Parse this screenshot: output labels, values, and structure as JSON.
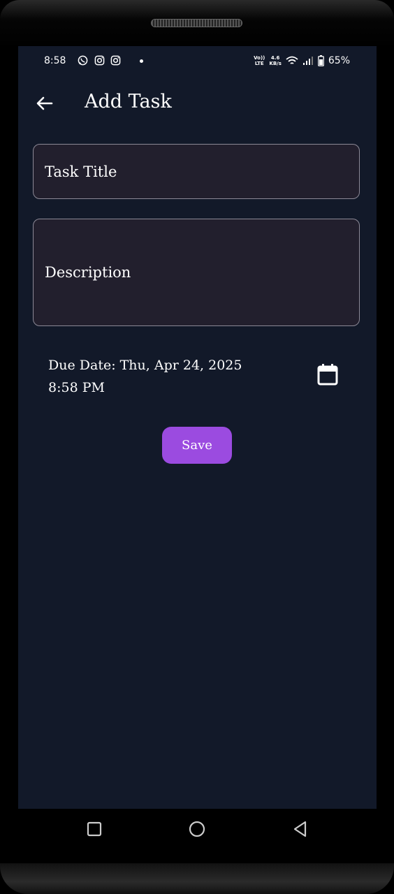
{
  "status_bar": {
    "time": "8:58",
    "net_speed_top": "4.6",
    "net_speed_bottom": "KB/s",
    "volte_top": "Vo))",
    "volte_bottom": "LTE",
    "battery": "65%"
  },
  "app_bar": {
    "title": "Add Task"
  },
  "form": {
    "title_placeholder": "Task Title",
    "description_placeholder": "Description",
    "due_date_line1": "Due Date: Thu, Apr 24, 2025",
    "due_date_line2": "8:58 PM",
    "save_label": "Save"
  },
  "colors": {
    "background": "#121929",
    "field_bg": "#221f2d",
    "accent": "#9b4be0"
  },
  "icons": [
    "whatsapp-icon",
    "instagram-icon",
    "instagram-icon",
    "wifi-icon",
    "signal-icon",
    "battery-icon",
    "back-arrow-icon",
    "calendar-icon",
    "recents-icon",
    "home-icon",
    "back-icon"
  ]
}
